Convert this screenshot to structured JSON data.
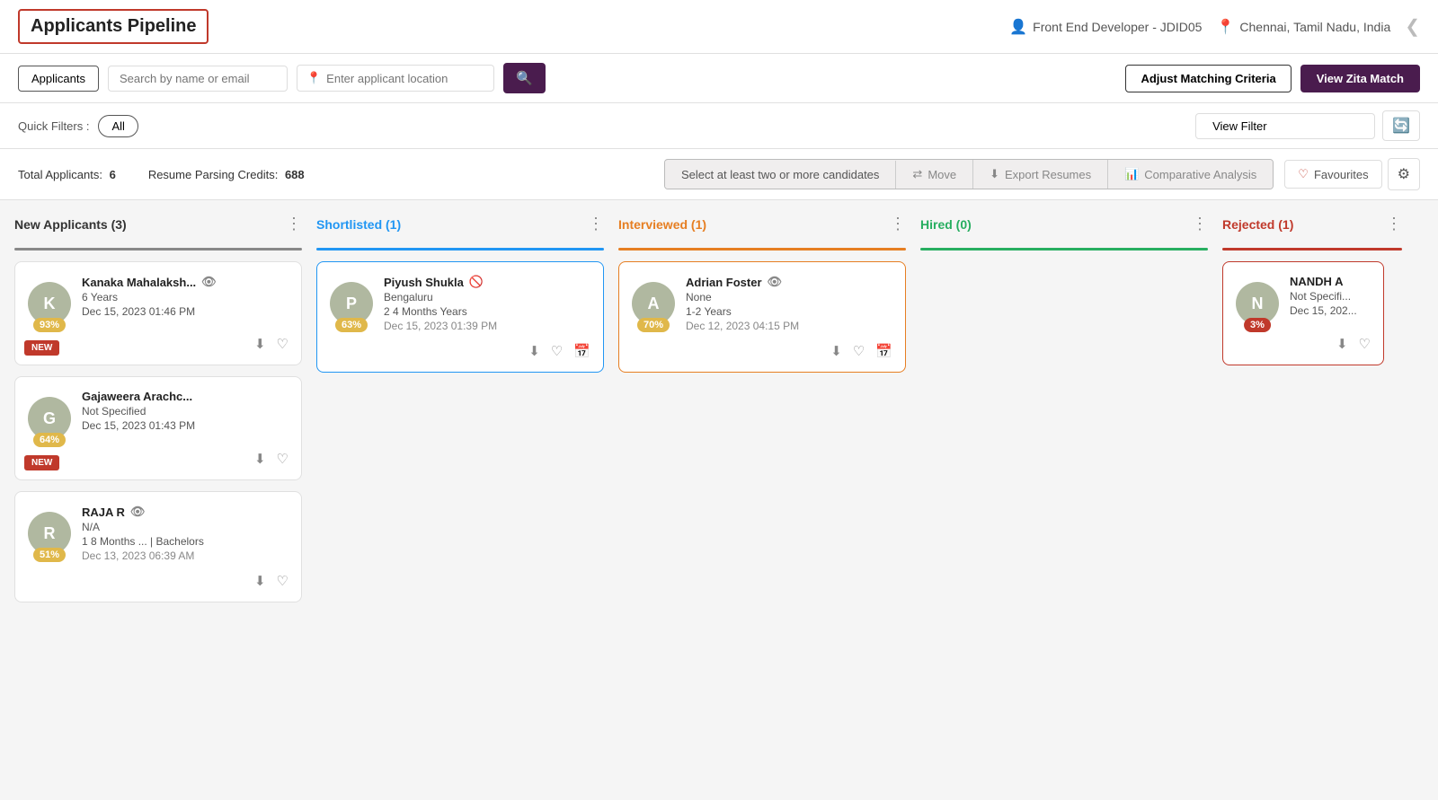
{
  "header": {
    "title": "Applicants Pipeline",
    "job": "Front End Developer - JDID05",
    "location": "Chennai, Tamil Nadu, India"
  },
  "toolbar": {
    "applicants_tab": "Applicants",
    "search_placeholder": "Search by name or email",
    "location_placeholder": "Enter applicant location",
    "adjust_btn": "Adjust Matching Criteria",
    "zita_btn": "View Zita Match"
  },
  "filters": {
    "quick_label": "Quick Filters :",
    "all_btn": "All",
    "view_filter_btn": "View Filter"
  },
  "stats": {
    "total_label": "Total Applicants:",
    "total_value": "6",
    "credits_label": "Resume Parsing Credits:",
    "credits_value": "688",
    "select_info": "Select at least two or more candidates",
    "move_label": "Move",
    "export_label": "Export Resumes",
    "analysis_label": "Comparative Analysis",
    "favourites_label": "Favourites"
  },
  "columns": [
    {
      "id": "new",
      "title": "New Applicants (3)",
      "color_class": "new-col",
      "cards": [
        {
          "id": "k1",
          "avatar_letter": "K",
          "name": "Kanaka Mahalaksh...",
          "location": "6 Years",
          "exp": "Dec 15, 2023 01:46 PM",
          "score": "93%",
          "score_class": "medium",
          "is_new": true,
          "has_eye": true
        },
        {
          "id": "g1",
          "avatar_letter": "G",
          "name": "Gajaweera Arachc...",
          "location": "Not Specified",
          "exp": "Dec 15, 2023 01:43 PM",
          "score": "64%",
          "score_class": "medium",
          "is_new": true,
          "has_eye": false
        },
        {
          "id": "r1",
          "avatar_letter": "R",
          "name": "RAJA R",
          "location": "N/A",
          "exp": "1 8 Months ... | Bachelors",
          "date": "Dec 13, 2023 06:39 AM",
          "score": "51%",
          "score_class": "medium",
          "is_new": false,
          "has_eye": true
        }
      ]
    },
    {
      "id": "shortlisted",
      "title": "Shortlisted (1)",
      "color_class": "shortlisted",
      "cards": [
        {
          "id": "p1",
          "avatar_letter": "P",
          "name": "Piyush Shukla",
          "location": "Bengaluru",
          "exp": "2 4 Months Years",
          "date": "Dec 15, 2023 01:39 PM",
          "score": "63%",
          "score_class": "medium",
          "is_new": false,
          "has_eye": false,
          "has_slash_eye": true
        }
      ]
    },
    {
      "id": "interviewed",
      "title": "Interviewed (1)",
      "color_class": "interviewed",
      "cards": [
        {
          "id": "a1",
          "avatar_letter": "A",
          "name": "Adrian Foster",
          "location": "None",
          "exp": "1-2 Years",
          "date": "Dec 12, 2023 04:15 PM",
          "score": "70%",
          "score_class": "medium",
          "is_new": false,
          "has_eye": true
        }
      ]
    },
    {
      "id": "hired",
      "title": "Hired (0)",
      "color_class": "hired",
      "cards": []
    },
    {
      "id": "rejected",
      "title": "Rejected (1)",
      "color_class": "rejected",
      "cards": [
        {
          "id": "n1",
          "avatar_letter": "N",
          "name": "NANDH A",
          "location": "Not Specifi...",
          "exp": "Dec 15, 202...",
          "score": "3%",
          "score_class": "low",
          "is_new": false,
          "has_eye": false,
          "partial": true
        }
      ]
    }
  ]
}
